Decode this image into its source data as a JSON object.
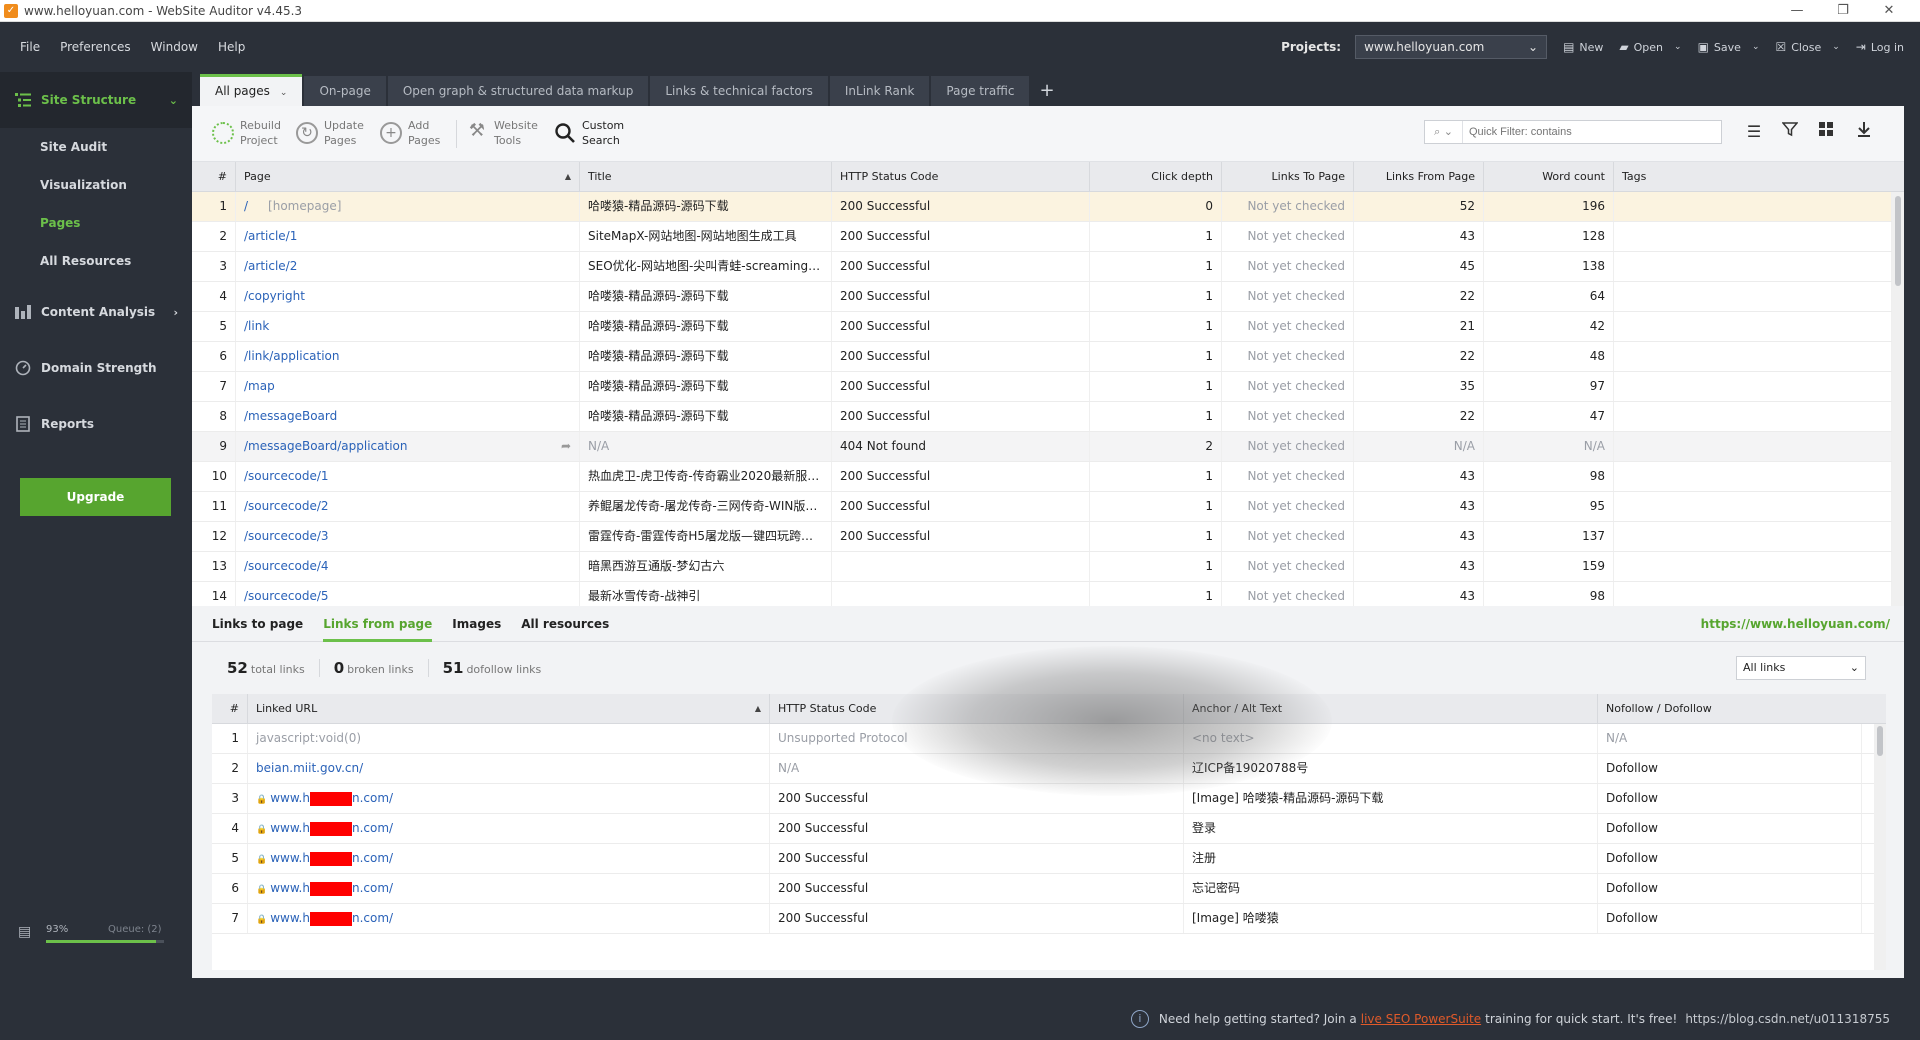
{
  "window": {
    "title": "www.helloyuan.com - WebSite Auditor v4.45.3",
    "controls": [
      "—",
      "❐",
      "✕"
    ]
  },
  "menu": [
    "File",
    "Preferences",
    "Window",
    "Help"
  ],
  "projects": {
    "label": "Projects:",
    "selected": "www.helloyuan.com"
  },
  "toolbar_buttons": {
    "new": "New",
    "open": "Open",
    "save": "Save",
    "close": "Close",
    "login": "Log in"
  },
  "sidebar": {
    "sections": [
      {
        "label": "Site Structure",
        "active": true
      },
      {
        "label": "Content Analysis"
      },
      {
        "label": "Domain Strength"
      },
      {
        "label": "Reports"
      }
    ],
    "sub_items": [
      "Site Audit",
      "Visualization",
      "Pages",
      "All Resources"
    ],
    "active_sub": "Pages",
    "upgrade": "Upgrade",
    "progress_label": "93%",
    "progress_value": 0.93,
    "queue": "Queue: (2)"
  },
  "tabs": [
    "All pages",
    "On-page",
    "Open graph & structured data markup",
    "Links & technical factors",
    "InLink Rank",
    "Page traffic"
  ],
  "tools": {
    "rebuild": [
      "Rebuild",
      "Project"
    ],
    "update": [
      "Update",
      "Pages"
    ],
    "add": [
      "Add",
      "Pages"
    ],
    "website_tools": [
      "Website",
      "Tools"
    ],
    "custom_search": [
      "Custom",
      "Search"
    ],
    "filter_placeholder": "Quick Filter: contains"
  },
  "pages_table": {
    "columns": [
      "#",
      "Page",
      "Title",
      "HTTP Status Code",
      "Click depth",
      "Links To Page",
      "Links From Page",
      "Word count",
      "Tags"
    ],
    "rows": [
      [
        "1",
        "/",
        "[homepage]",
        "哈喽猿-精品源码-源码下载",
        "200 Successful",
        "0",
        "Not yet checked",
        "52",
        "196"
      ],
      [
        "2",
        "/article/1",
        "",
        "SiteMapX-网站地图-网站地图生成工具",
        "200 Successful",
        "1",
        "Not yet checked",
        "43",
        "128"
      ],
      [
        "3",
        "/article/2",
        "",
        "SEO优化-网站地图-尖叫青蛙-screamingfrog",
        "200 Successful",
        "1",
        "Not yet checked",
        "45",
        "138"
      ],
      [
        "4",
        "/copyright",
        "",
        "哈喽猿-精品源码-源码下载",
        "200 Successful",
        "1",
        "Not yet checked",
        "22",
        "64"
      ],
      [
        "5",
        "/link",
        "",
        "哈喽猿-精品源码-源码下载",
        "200 Successful",
        "1",
        "Not yet checked",
        "21",
        "42"
      ],
      [
        "6",
        "/link/application",
        "",
        "哈喽猿-精品源码-源码下载",
        "200 Successful",
        "1",
        "Not yet checked",
        "22",
        "48"
      ],
      [
        "7",
        "/map",
        "",
        "哈喽猿-精品源码-源码下载",
        "200 Successful",
        "1",
        "Not yet checked",
        "35",
        "97"
      ],
      [
        "8",
        "/messageBoard",
        "",
        "哈喽猿-精品源码-源码下载",
        "200 Successful",
        "1",
        "Not yet checked",
        "22",
        "47"
      ],
      [
        "9",
        "/messageBoard/application",
        "",
        "N/A",
        "404 Not found",
        "2",
        "Not yet checked",
        "N/A",
        "N/A"
      ],
      [
        "10",
        "/sourcecode/1",
        "",
        "热血虎卫-虎卫传奇-传奇霸业2020最新服务...",
        "200 Successful",
        "1",
        "Not yet checked",
        "43",
        "98"
      ],
      [
        "11",
        "/sourcecode/2",
        "",
        "养鲲屠龙传奇-屠龙传奇-三网传奇-WIN版—...",
        "200 Successful",
        "1",
        "Not yet checked",
        "43",
        "95"
      ],
      [
        "12",
        "/sourcecode/3",
        "",
        "雷霆传奇-雷霆传奇H5屠龙版—键四玩跨服...",
        "200 Successful",
        "1",
        "Not yet checked",
        "43",
        "137"
      ],
      [
        "13",
        "/sourcecode/4",
        "",
        "暗黑西游互通版-梦幻古六",
        "",
        "1",
        "Not yet checked",
        "43",
        "159"
      ],
      [
        "14",
        "/sourcecode/5",
        "",
        "最新冰雪传奇-战神引",
        "",
        "1",
        "Not yet checked",
        "43",
        "98"
      ]
    ]
  },
  "bottom": {
    "tabs": [
      "Links to page",
      "Links from page",
      "Images",
      "All resources"
    ],
    "active_tab": "Links from page",
    "url": "https://www.helloyuan.com/",
    "stats": [
      {
        "value": "52",
        "label": "total links"
      },
      {
        "value": "0",
        "label": "broken links"
      },
      {
        "value": "51",
        "label": "dofollow links"
      }
    ],
    "filter": "All links",
    "columns": [
      "#",
      "Linked URL",
      "HTTP Status Code",
      "Anchor / Alt Text",
      "Nofollow / Dofollow"
    ],
    "rows": [
      [
        "1",
        "javascript:void(0)",
        "Unsupported Protocol",
        "<no text>",
        "N/A",
        "gray"
      ],
      [
        "2",
        "beian.miit.gov.cn/",
        "N/A",
        "辽ICP备19020788号",
        "Dofollow",
        "plain"
      ],
      [
        "3",
        "www.h",
        "200 Successful",
        "[Image] 哈喽猿-精品源码-源码下载",
        "Dofollow",
        "lock"
      ],
      [
        "4",
        "www.h",
        "200 Successful",
        "登录",
        "Dofollow",
        "lock"
      ],
      [
        "5",
        "www.h",
        "200 Successful",
        "注册",
        "Dofollow",
        "lock"
      ],
      [
        "6",
        "www.h",
        "200 Successful",
        "忘记密码",
        "Dofollow",
        "lock"
      ],
      [
        "7",
        "www.h",
        "200 Successful",
        "[Image] 哈喽猿",
        "Dofollow",
        "lock"
      ]
    ],
    "url_suffix": "n.com/"
  },
  "status": {
    "prefix": "Need help getting started? Join a",
    "link": "live SEO PowerSuite",
    "suffix": "training for quick start. It's free!",
    "watermark": "https://blog.csdn.net/u011318755"
  },
  "colors": {
    "accent": "#6cc04a",
    "sidebar_bg": "#2b3039",
    "link": "#2a62b8",
    "upgrade": "#57a52f"
  }
}
